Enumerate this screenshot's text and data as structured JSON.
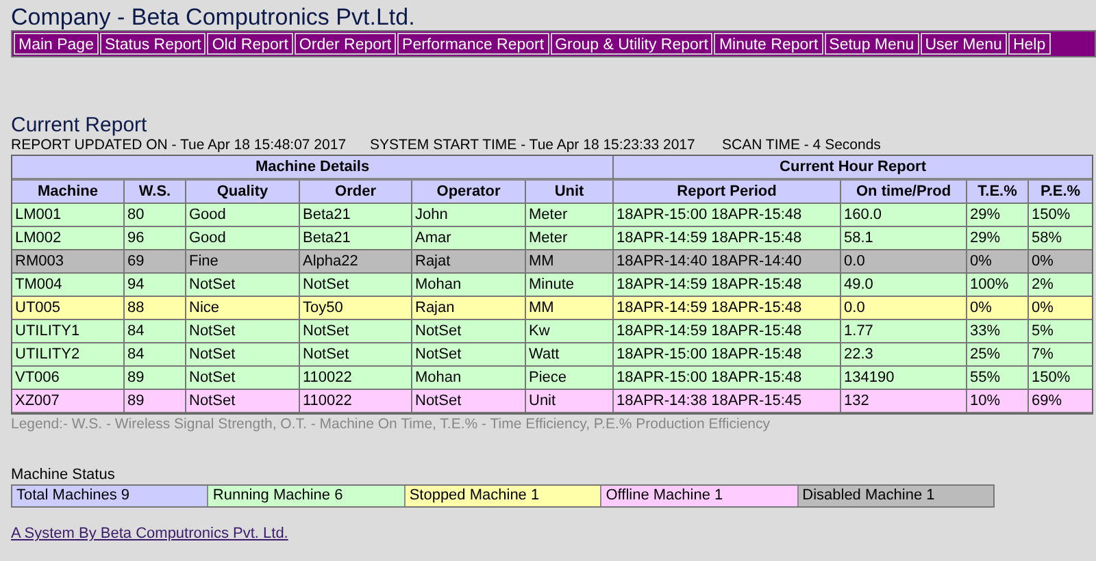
{
  "company_title": "Company - Beta Computronics Pvt.Ltd.",
  "menu": [
    {
      "label": "Main Page"
    },
    {
      "label": "Status Report"
    },
    {
      "label": "Old Report"
    },
    {
      "label": "Order Report"
    },
    {
      "label": "Performance Report"
    },
    {
      "label": "Group & Utility Report"
    },
    {
      "label": "Minute Report"
    },
    {
      "label": "Setup Menu"
    },
    {
      "label": "User Menu"
    },
    {
      "label": "Help"
    }
  ],
  "report": {
    "title": "Current Report",
    "updated_on": "REPORT UPDATED ON - Tue Apr 18 15:48:07 2017",
    "system_start": "SYSTEM START TIME - Tue Apr 18 15:23:33 2017",
    "scan_time": "SCAN TIME - 4 Seconds"
  },
  "table": {
    "groups": [
      {
        "label": "Machine Details"
      },
      {
        "label": "Current Hour Report"
      }
    ],
    "columns": [
      "Machine",
      "W.S.",
      "Quality",
      "Order",
      "Operator",
      "Unit",
      "Report Period",
      "On time/Prod",
      "T.E.%",
      "P.E.%"
    ],
    "rows": [
      {
        "color": "#ccffcc",
        "cells": [
          "LM001",
          "80",
          "Good",
          "Beta21",
          "John",
          "Meter",
          "18APR-15:00 18APR-15:48",
          "160.0",
          "29%",
          "150%"
        ]
      },
      {
        "color": "#ccffcc",
        "cells": [
          "LM002",
          "96",
          "Good",
          "Beta21",
          "Amar",
          "Meter",
          "18APR-14:59 18APR-15:48",
          "58.1",
          "29%",
          "58%"
        ]
      },
      {
        "color": "#bbbbbb",
        "cells": [
          "RM003",
          "69",
          "Fine",
          "Alpha22",
          "Rajat",
          "MM",
          "18APR-14:40 18APR-14:40",
          "0.0",
          "0%",
          "0%"
        ]
      },
      {
        "color": "#ccffcc",
        "cells": [
          "TM004",
          "94",
          "NotSet",
          "NotSet",
          "Mohan",
          "Minute",
          "18APR-14:59 18APR-15:48",
          "49.0",
          "100%",
          "2%"
        ]
      },
      {
        "color": "#ffffaa",
        "cells": [
          "UT005",
          "88",
          "Nice",
          "Toy50",
          "Rajan",
          "MM",
          "18APR-14:59 18APR-15:48",
          "0.0",
          "0%",
          "0%"
        ]
      },
      {
        "color": "#ccffcc",
        "cells": [
          "UTILITY1",
          "84",
          "NotSet",
          "NotSet",
          "NotSet",
          "Kw",
          "18APR-14:59 18APR-15:48",
          "1.77",
          "33%",
          "5%"
        ]
      },
      {
        "color": "#ccffcc",
        "cells": [
          "UTILITY2",
          "84",
          "NotSet",
          "NotSet",
          "NotSet",
          "Watt",
          "18APR-15:00 18APR-15:48",
          "22.3",
          "25%",
          "7%"
        ]
      },
      {
        "color": "#ccffcc",
        "cells": [
          "VT006",
          "89",
          "NotSet",
          "110022",
          "Mohan",
          "Piece",
          "18APR-15:00 18APR-15:48",
          "134190",
          "55%",
          "150%"
        ]
      },
      {
        "color": "#ffccff",
        "cells": [
          "XZ007",
          "89",
          "NotSet",
          "110022",
          "NotSet",
          "Unit",
          "18APR-14:38 18APR-15:45",
          "132",
          "10%",
          "69%"
        ]
      }
    ]
  },
  "legend": "Legend:- W.S. - Wireless Signal Strength, O.T. - Machine On Time, T.E.% - Time Efficiency, P.E.% Production Efficiency",
  "machine_status": {
    "title": "Machine Status",
    "items": [
      {
        "label": "Total Machines 9",
        "color": "#ccccff"
      },
      {
        "label": "Running Machine 6",
        "color": "#ccffcc"
      },
      {
        "label": "Stopped Machine 1",
        "color": "#ffffaa"
      },
      {
        "label": "Offline Machine 1",
        "color": "#ffccff"
      },
      {
        "label": "Disabled Machine 1",
        "color": "#bbbbbb"
      }
    ]
  },
  "footer_link": "A System By Beta Computronics Pvt. Ltd."
}
